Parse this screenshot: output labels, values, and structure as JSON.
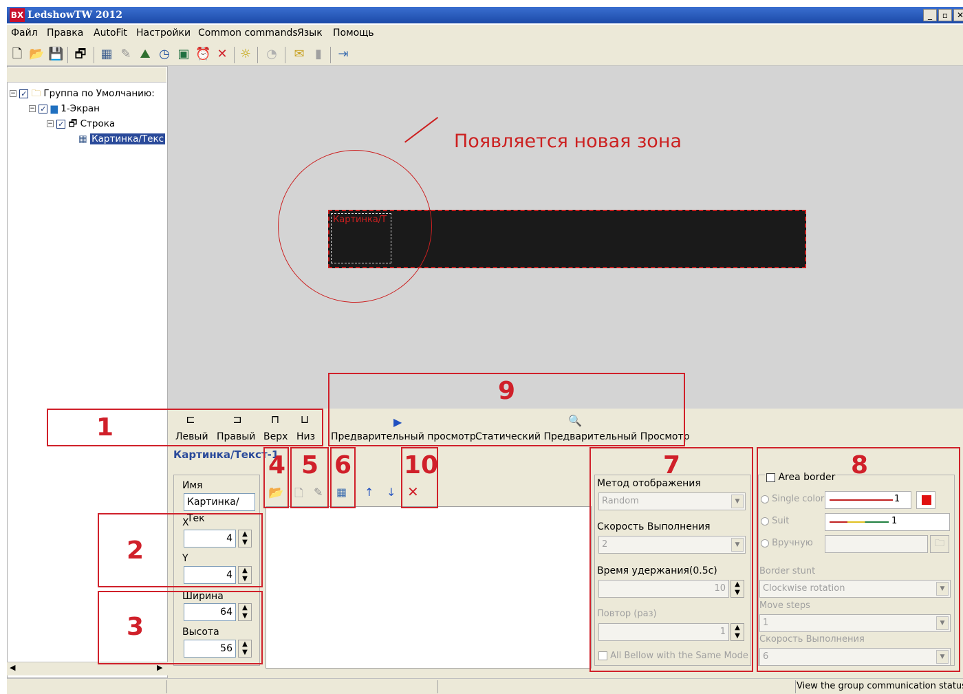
{
  "window": {
    "title": "LedshowTW 2012",
    "logo": "BX",
    "min": "_",
    "max": "▫",
    "close": "✕"
  },
  "menu": [
    "Файл",
    "Правка",
    "AutoFit",
    "Настройки",
    "Common commands",
    "Язык",
    "Помощь"
  ],
  "tree": {
    "group": "Группа по Умолчанию:",
    "screen": "1-Экран",
    "row": "Строка",
    "item": "Картинка/Текс"
  },
  "annotation": {
    "text": "Появляется новая зона"
  },
  "zone_label": "Картинка/Т",
  "align_buttons": {
    "left": "Левый",
    "right": "Правый",
    "top": "Верх",
    "bottom": "Низ"
  },
  "preview": {
    "preview_label": "Предварительный просмотр",
    "static_label": "Статический Предварительный Просмотр"
  },
  "area_title": "Картинка/Текст-1",
  "props": {
    "name_label": "Имя",
    "name_value": "Картинка/Тек",
    "x_label": "X",
    "x_value": "4",
    "y_label": "Y",
    "y_value": "4",
    "width_label": "Ширина",
    "width_value": "64",
    "height_label": "Высота",
    "height_value": "56"
  },
  "display": {
    "method_label": "Метод отображения",
    "method_value": "Random",
    "speed_label": "Скорость Выполнения",
    "speed_value": "2",
    "hold_label": "Время удержания(0.5с)",
    "hold_value": "10",
    "repeat_label": "Повтор (раз)",
    "repeat_value": "1",
    "all_same": "All Bellow with the Same Mode"
  },
  "border": {
    "area_border": "Area border",
    "single_color": "Single color",
    "single_value": "1",
    "suit": "Suit",
    "suit_value": "1",
    "manual": "Вручную",
    "stunt_label": "Border stunt",
    "stunt_value": "Clockwise rotation",
    "steps_label": "Move steps",
    "steps_value": "1",
    "speed_label": "Скорость Выполнения",
    "speed_value": "6"
  },
  "callouts": {
    "n1": "1",
    "n2": "2",
    "n3": "3",
    "n4": "4",
    "n5": "5",
    "n6": "6",
    "n7": "7",
    "n8": "8",
    "n9": "9",
    "n10": "10"
  },
  "status": {
    "text": "View the group communication status"
  },
  "colors": {
    "accent_red": "#d0202a",
    "title_blue": "#1c4aa8",
    "canvas_gray": "#d4d4d4"
  }
}
